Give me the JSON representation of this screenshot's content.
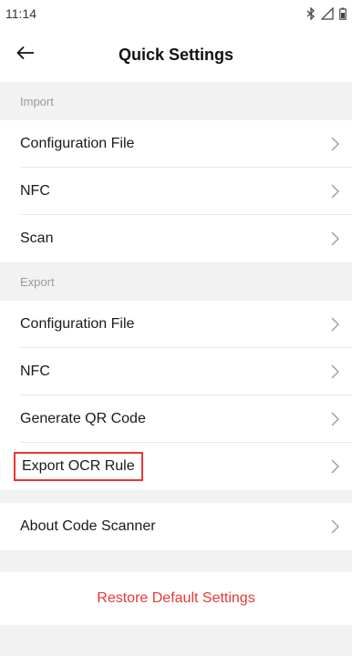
{
  "status_bar": {
    "time": "11:14"
  },
  "header": {
    "title": "Quick Settings"
  },
  "sections": [
    {
      "title": "Import",
      "items": [
        {
          "label": "Configuration File"
        },
        {
          "label": "NFC"
        },
        {
          "label": "Scan"
        }
      ]
    },
    {
      "title": "Export",
      "items": [
        {
          "label": "Configuration File"
        },
        {
          "label": "NFC"
        },
        {
          "label": "Generate QR Code"
        },
        {
          "label": "Export OCR Rule",
          "highlighted": true
        }
      ]
    }
  ],
  "about": {
    "label": "About Code Scanner"
  },
  "restore": {
    "label": "Restore Default Settings"
  },
  "colors": {
    "accent_red": "#e53935",
    "background": "#f2f2f2",
    "surface": "#ffffff"
  },
  "icons": [
    "bluetooth-icon",
    "signal-icon",
    "battery-icon",
    "back-arrow-icon",
    "chevron-right-icon"
  ]
}
